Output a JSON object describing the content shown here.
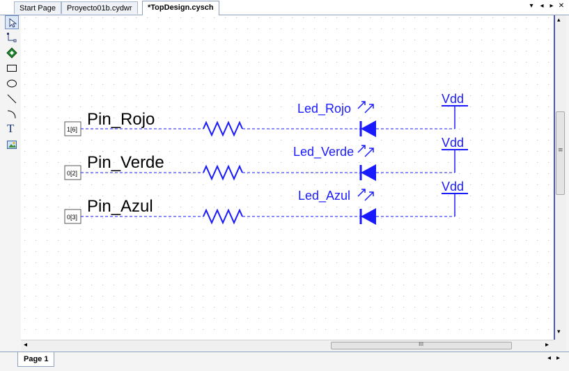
{
  "tabs": [
    {
      "label": "Start Page"
    },
    {
      "label": "Proyecto01b.cydwr"
    },
    {
      "label": "*TopDesign.cysch"
    }
  ],
  "tab_controls": {
    "dropdown": "▾",
    "left": "◂",
    "right": "▸",
    "close": "✕"
  },
  "toolbox": [
    {
      "name": "pointer-icon"
    },
    {
      "name": "wire-icon"
    },
    {
      "name": "component-icon"
    },
    {
      "name": "rectangle-icon"
    },
    {
      "name": "ellipse-icon"
    },
    {
      "name": "line-icon"
    },
    {
      "name": "arc-icon"
    },
    {
      "name": "text-icon",
      "glyph": "T"
    },
    {
      "name": "image-icon"
    }
  ],
  "schematic": {
    "colors": {
      "wire": "#1a1aff",
      "pin_text": "#000000",
      "grid_dot": "#b8b8b8"
    },
    "rows": [
      {
        "pin_label": "Pin_Rojo",
        "pin_value": "1[6]",
        "led_label": "Led_Rojo",
        "vdd_label": "Vdd"
      },
      {
        "pin_label": "Pin_Verde",
        "pin_value": "0[2]",
        "led_label": "Led_Verde",
        "vdd_label": "Vdd"
      },
      {
        "pin_label": "Pin_Azul",
        "pin_value": "0[3]",
        "led_label": "Led_Azul",
        "vdd_label": "Vdd"
      }
    ]
  },
  "hscroll": {
    "thumb_grip": "III",
    "left": "◂",
    "right": "▸"
  },
  "vscroll": {
    "thumb_grip": "≡",
    "up": "▴",
    "down": "▾"
  },
  "page_tabs": [
    {
      "label": "Page 1"
    }
  ],
  "page_nav": {
    "left": "◂",
    "right": "▸"
  }
}
